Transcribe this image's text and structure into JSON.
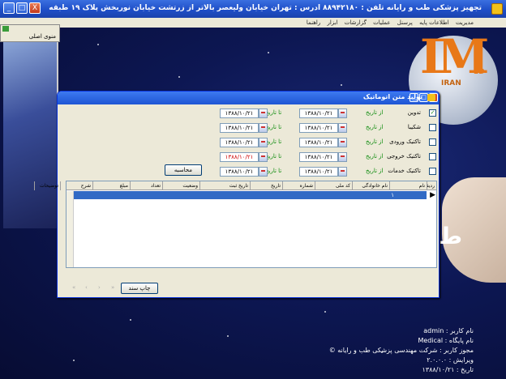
{
  "window": {
    "title": "تجهیز پزشکی طب و رایانه  تلفن : ۸۸۹۴۲۱۸۰  آدرس : تهران خیابان ولیعصر بالاتر از زرتشت خیابان نوربخش پلاک ۱۹ طبقه سوم  سیستم جامع اطلاعات و مدیریت ...",
    "min_label": "_",
    "max_label": "□",
    "close_label": "X"
  },
  "menu": [
    "مدیریت",
    "اطلاعات پایه",
    "پرسنل",
    "عملیات",
    "گزارشات",
    "ابزار",
    "راهنما"
  ],
  "left_panel": {
    "label": "منوی اصلی"
  },
  "logo": {
    "im": "IM",
    "ed": "ED",
    "iran": "IRAN"
  },
  "brand_letter": "ط",
  "info": {
    "version_line": "ویرایش : ۲.۰.۰.۰",
    "licensee_line": "مجوز کاربر : شرکت مهندسی پزشکی طب و رایانه ©",
    "user_line": "نام کاربر : admin",
    "db_line": "نام پایگاه : Medical",
    "date_line": "تاریخ : ۱۳۸۸/۱۰/۲۱"
  },
  "dialog": {
    "title": "تولید متن اتوماتیک",
    "rows": [
      {
        "checked": true,
        "label": "تدوین",
        "label_color": "black",
        "from_label": "از تاریخ",
        "to_label": "تا تاریخ",
        "from": "۱۳۸۸/۱۰/۲۱",
        "to": "۱۳۸۸/۱۰/۲۱",
        "to_color": "black"
      },
      {
        "checked": false,
        "label": "شکیبا",
        "label_color": "black",
        "from_label": "از تاریخ",
        "to_label": "تا تاریخ",
        "from": "۱۳۸۸/۱۰/۲۱",
        "to": "۱۳۸۸/۱۰/۲۱",
        "to_color": "black"
      },
      {
        "checked": false,
        "label": "تاکتیک ورودی",
        "label_color": "black",
        "from_label": "از تاریخ",
        "to_label": "تا تاریخ",
        "from": "۱۳۸۸/۱۰/۲۱",
        "to": "۱۳۸۸/۱۰/۲۱",
        "to_color": "black"
      },
      {
        "checked": false,
        "label": "تاکتیک خروجی",
        "label_color": "black",
        "from_label": "از تاریخ",
        "to_label": "تا تاریخ",
        "from": "۱۳۸۸/۱۰/۲۱",
        "to": "۱۳۸۸/۱۰/۲۱",
        "to_color": "red"
      },
      {
        "checked": false,
        "label": "تاکتیک خدمات",
        "label_color": "black",
        "from_label": "از تاریخ",
        "to_label": "تا تاریخ",
        "from": "۱۳۸۸/۱۰/۲۱",
        "to": "۱۳۸۸/۱۰/۲۱",
        "to_color": "black"
      }
    ],
    "calc_button": "محاسبه",
    "grid_columns": [
      "ردیف",
      "نام",
      "نام خانوادگی",
      "کد ملی",
      "شماره",
      "تاریخ",
      "تاریخ ثبت",
      "وضعیت",
      "تعداد",
      "مبلغ",
      "شرح",
      "توضیحات"
    ],
    "selected_row_cell": "۱",
    "print_button": "چاپ سند",
    "nav": [
      "«",
      "‹",
      "›",
      "»"
    ]
  }
}
